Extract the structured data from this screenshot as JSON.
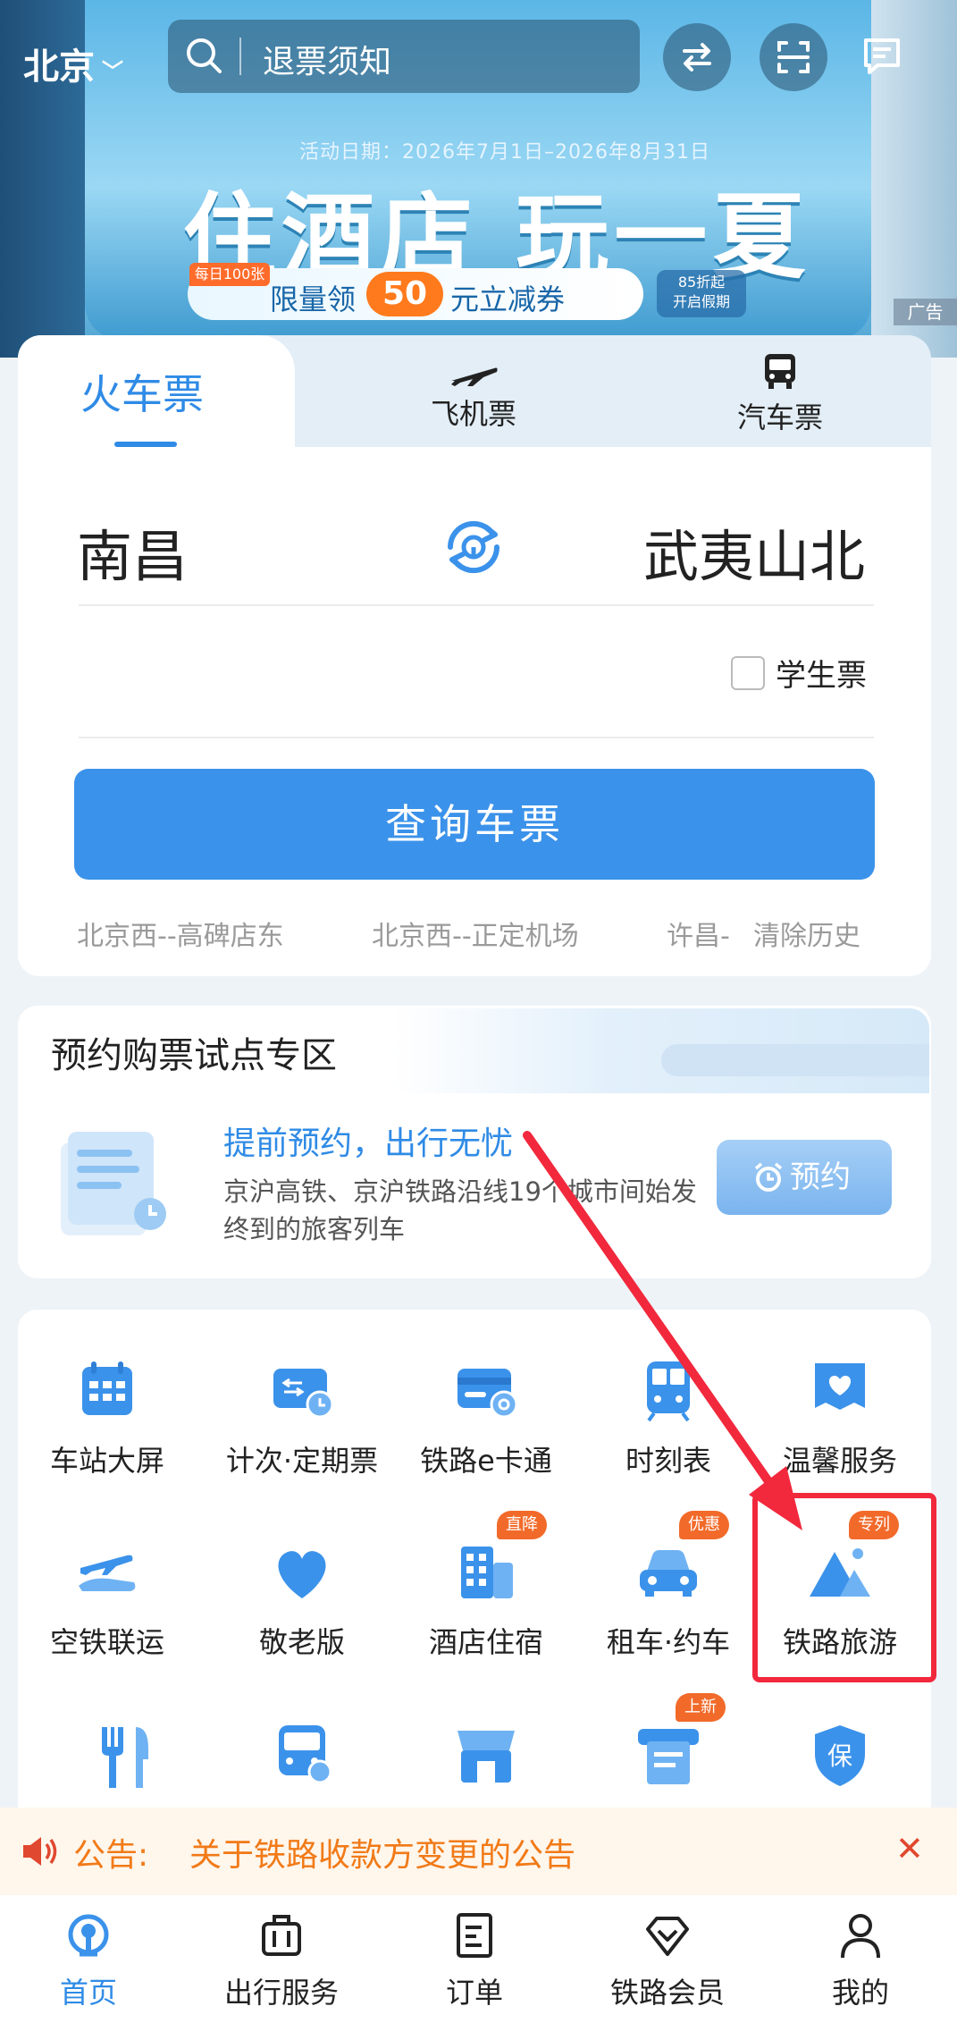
{
  "header": {
    "city": "北京",
    "search_placeholder": "退票须知"
  },
  "banner": {
    "date_text": "活动日期：2026年7月1日–2026年8月31日",
    "title": "住酒店 玩一夏",
    "daily_tag": "每日100张",
    "pill_text_before": "限量领",
    "pill_number": "50",
    "pill_text_after": "元立减券",
    "discount_line1": "85折起",
    "discount_line2": "开启假期",
    "ad_label": "广告"
  },
  "tabs": [
    {
      "label": "火车票",
      "active": true
    },
    {
      "label": "飞机票",
      "active": false
    },
    {
      "label": "汽车票",
      "active": false
    }
  ],
  "route": {
    "from": "南昌",
    "to": "武夷山北"
  },
  "student_ticket_label": "学生票",
  "query_button": "查询车票",
  "history": [
    "北京西--高碑店东",
    "北京西--正定机场",
    "许昌-"
  ],
  "clear_history": "清除历史",
  "reservation": {
    "title": "预约购票试点专区",
    "headline": "提前预约，出行无忧",
    "desc": "京沪高铁、京沪铁路沿线19个城市间始发终到的旅客列车",
    "button": "预约"
  },
  "services": [
    {
      "label": "车站大屏",
      "icon": "station-screen-icon"
    },
    {
      "label": "计次·定期票",
      "icon": "ticket-calendar-icon"
    },
    {
      "label": "铁路e卡通",
      "icon": "rail-card-icon"
    },
    {
      "label": "时刻表",
      "icon": "timetable-icon"
    },
    {
      "label": "温馨服务",
      "icon": "care-service-icon"
    },
    {
      "label": "空铁联运",
      "icon": "air-rail-icon"
    },
    {
      "label": "敬老版",
      "icon": "heart-icon"
    },
    {
      "label": "酒店住宿",
      "icon": "hotel-icon",
      "badge": "直降"
    },
    {
      "label": "租车·约车",
      "icon": "car-icon",
      "badge": "优惠"
    },
    {
      "label": "铁路旅游",
      "icon": "mountain-icon",
      "badge": "专列"
    }
  ],
  "services_row3_badge": "上新",
  "notice": {
    "label": "公告:",
    "text": "关于铁路收款方变更的公告"
  },
  "bottom_nav": [
    {
      "label": "首页",
      "active": true
    },
    {
      "label": "出行服务",
      "active": false
    },
    {
      "label": "订单",
      "active": false
    },
    {
      "label": "铁路会员",
      "active": false
    },
    {
      "label": "我的",
      "active": false
    }
  ],
  "colors": {
    "primary": "#3b92ea",
    "accent_orange": "#f17a17",
    "highlight_red": "#f2283c"
  }
}
